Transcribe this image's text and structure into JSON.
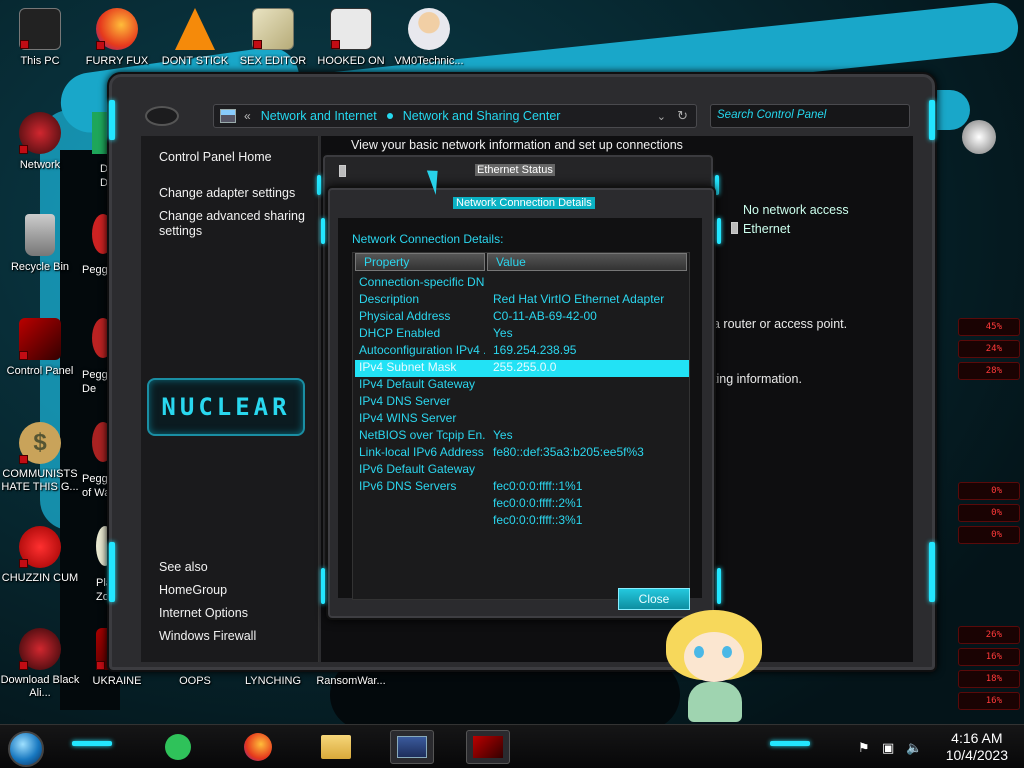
{
  "desktop": {
    "icons": [
      {
        "label": "This PC"
      },
      {
        "label": "FURRY FUX"
      },
      {
        "label": "DONT STICK"
      },
      {
        "label": "SEX EDITOR"
      },
      {
        "label": "HOOKED ON"
      },
      {
        "label": "VM0Technic..."
      },
      {
        "label": "Network"
      },
      {
        "label": "Recycle Bin"
      },
      {
        "label": "Control Panel"
      },
      {
        "label": "COMMUNISTS HATE THIS G..."
      },
      {
        "label": "CHUZZIN CUM"
      },
      {
        "label": "Download Black Ali..."
      },
      {
        "label": "UKRAINE"
      },
      {
        "label": "OOPS"
      },
      {
        "label": "LYNCHING"
      },
      {
        "label": "RansomWar..."
      }
    ],
    "partial_labels": {
      "d1": "D",
      "d2": "DUM",
      "peggle1": "Peggle",
      "peggle2": "Peggle",
      "peggle2b": "De",
      "peggle3": "Peggle",
      "peggle3b": "of Wa",
      "plan1": "Plan",
      "plan2": "Zo"
    },
    "icon_glyphs": {
      "money": "$"
    }
  },
  "control_panel": {
    "breadcrumb": [
      "Network and Internet",
      "Network and Sharing Center"
    ],
    "breadcrumb_sep": "«",
    "search_placeholder": "Search Control Panel",
    "sidebar": {
      "home": "Control Panel Home",
      "links": [
        "Change adapter settings",
        "Change advanced sharing settings"
      ],
      "see_also_title": "See also",
      "see_also": [
        "HomeGroup",
        "Internet Options",
        "Windows Firewall"
      ],
      "logo_text": "NUCLEAR"
    },
    "main": {
      "header": "View your basic network information and set up connections",
      "access": "No network access",
      "connection": "Ethernet",
      "text1": "a router or access point.",
      "text2": "ting information."
    }
  },
  "ethernet_status": {
    "title": "Ethernet Status"
  },
  "details_dialog": {
    "title": "Network Connection Details",
    "label": "Network Connection Details:",
    "columns": [
      "Property",
      "Value"
    ],
    "rows": [
      {
        "property": "Connection-specific DN...",
        "value": ""
      },
      {
        "property": "Description",
        "value": "Red Hat VirtIO Ethernet Adapter"
      },
      {
        "property": "Physical Address",
        "value": "C0-11-AB-69-42-00"
      },
      {
        "property": "DHCP Enabled",
        "value": "Yes"
      },
      {
        "property": "Autoconfiguration IPv4 ...",
        "value": "169.254.238.95"
      },
      {
        "property": "IPv4 Subnet Mask",
        "value": "255.255.0.0",
        "selected": true
      },
      {
        "property": "IPv4 Default Gateway",
        "value": ""
      },
      {
        "property": "IPv4 DNS Server",
        "value": ""
      },
      {
        "property": "IPv4 WINS Server",
        "value": ""
      },
      {
        "property": "NetBIOS over Tcpip En...",
        "value": "Yes"
      },
      {
        "property": "Link-local IPv6 Address",
        "value": "fe80::def:35a3:b205:ee5f%3"
      },
      {
        "property": "IPv6 Default Gateway",
        "value": ""
      },
      {
        "property": "IPv6 DNS Servers",
        "value": "fec0:0:0:ffff::1%1"
      },
      {
        "property": "",
        "value": "fec0:0:0:ffff::2%1"
      },
      {
        "property": "",
        "value": "fec0:0:0:ffff::3%1"
      }
    ],
    "close_label": "Close"
  },
  "hud": {
    "values": [
      "45%",
      "24%",
      "28%",
      "0%",
      "0%",
      "0%",
      "26%",
      "16%",
      "18%",
      "16%"
    ]
  },
  "taskbar": {
    "time": "4:16 AM",
    "date": "10/4/2023"
  },
  "colors": {
    "accent": "#25d8ef",
    "selection": "#22e2f5",
    "hud_red": "#ff3a3a"
  }
}
